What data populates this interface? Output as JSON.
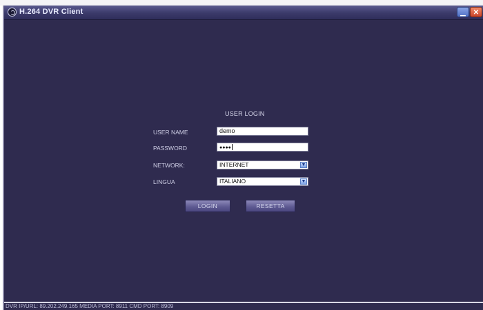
{
  "window": {
    "title": "H.264 DVR Client",
    "minimize_icon": "minimize-icon",
    "close_icon": "close-icon",
    "close_glyph": "✕",
    "minimize_glyph": "▁"
  },
  "login": {
    "title": "USER LOGIN",
    "username_label": "USER NAME",
    "username_value": "demo",
    "password_label": "PASSWORD",
    "password_mask": "●●●●",
    "network_label": "NETWORK:",
    "network_value": "INTERNET",
    "language_label": "LINGUA",
    "language_value": "ITALIANO",
    "login_button": "LOGIN",
    "reset_button": "RESETTA"
  },
  "status_bar": {
    "text": "DVR IP/URL: 89.202.249.165  MEDIA PORT: 8911  CMD PORT: 8909"
  },
  "colors": {
    "background": "#2f2b4f",
    "titlebar": "#3b3a6a",
    "button": "#5c5890"
  }
}
